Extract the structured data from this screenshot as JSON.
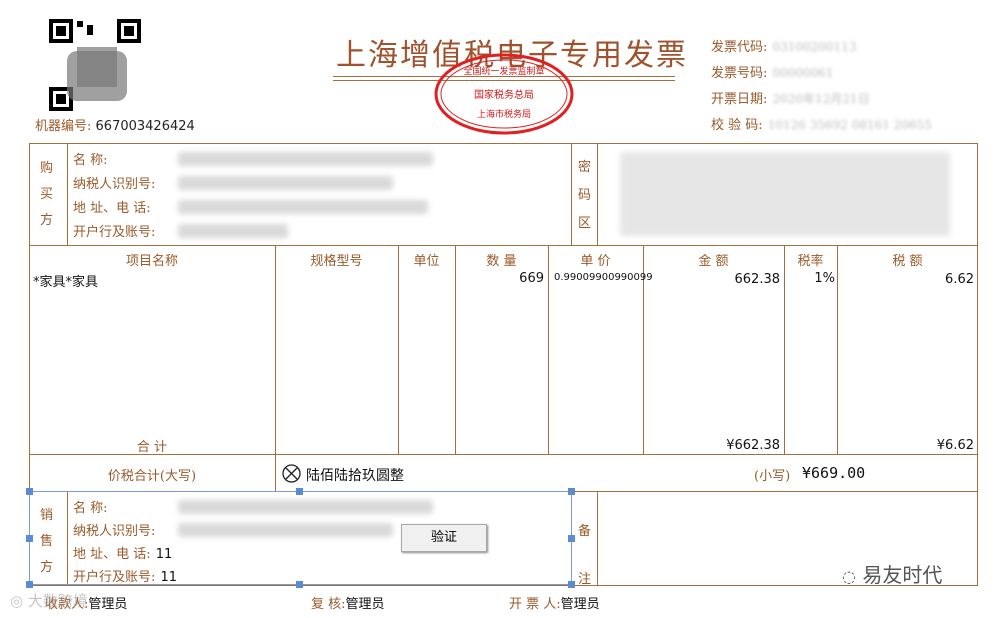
{
  "invoice": {
    "title": "上海增值税电子专用发票",
    "machine_no_label": "机器编号:",
    "machine_no": "667003426424",
    "seal": {
      "top": "全国统一发票监制章",
      "middle": "国家税务总局",
      "bottom": "上海市税务局"
    },
    "meta": [
      {
        "label": "发票代码:",
        "value": "03100200113"
      },
      {
        "label": "发票号码:",
        "value": "00000061"
      },
      {
        "label": "开票日期:",
        "value": "2020年12月21日"
      },
      {
        "label": "校 验 码:",
        "value": "10126 35692 08161 20655"
      }
    ]
  },
  "buyer": {
    "side_label": [
      "购",
      "买",
      "方"
    ],
    "fields": [
      {
        "label": "名          称:",
        "value": ""
      },
      {
        "label": "纳税人识别号:",
        "value": ""
      },
      {
        "label": "地 址、电 话:",
        "value": ""
      },
      {
        "label": "开户行及账号:",
        "value": ""
      }
    ],
    "password_area_label": [
      "密",
      "码",
      "区"
    ]
  },
  "items": {
    "headers": [
      "项目名称",
      "规格型号",
      "单位",
      "数 量",
      "单 价",
      "金 额",
      "税率",
      "税 额"
    ],
    "rows": [
      {
        "name": "*家具*家具",
        "spec": "",
        "unit": "",
        "qty": "669",
        "price": "0.99009900990099",
        "amount": "662.38",
        "rate": "1%",
        "tax": "6.62"
      }
    ],
    "total_label": "合          计",
    "total_amount": "¥662.38",
    "total_tax": "¥6.62"
  },
  "summary": {
    "label": "价税合计(大写)",
    "words_icon": "cross-circle-icon",
    "words": "陆佰陆拾玖圆整",
    "small_label": "(小写)",
    "small_value": "¥669.00"
  },
  "seller": {
    "side_label": [
      "销",
      "售",
      "方"
    ],
    "fields": [
      {
        "label": "名          称:",
        "value": ""
      },
      {
        "label": "纳税人识别号:",
        "value": ""
      },
      {
        "label": "地 址、电 话:",
        "value": "11"
      },
      {
        "label": "开户行及账号:",
        "value": "11"
      }
    ],
    "remark_label": [
      "备",
      "注"
    ],
    "verify_button": "验证"
  },
  "footer": {
    "payee_label": "收款人:",
    "payee": "管理员",
    "reviewer_label": "复 核:",
    "reviewer": "管理员",
    "issuer_label": "开 票 人:",
    "issuer": "管理员"
  },
  "watermarks": {
    "left": "大数跨境",
    "right": "易友时代"
  }
}
